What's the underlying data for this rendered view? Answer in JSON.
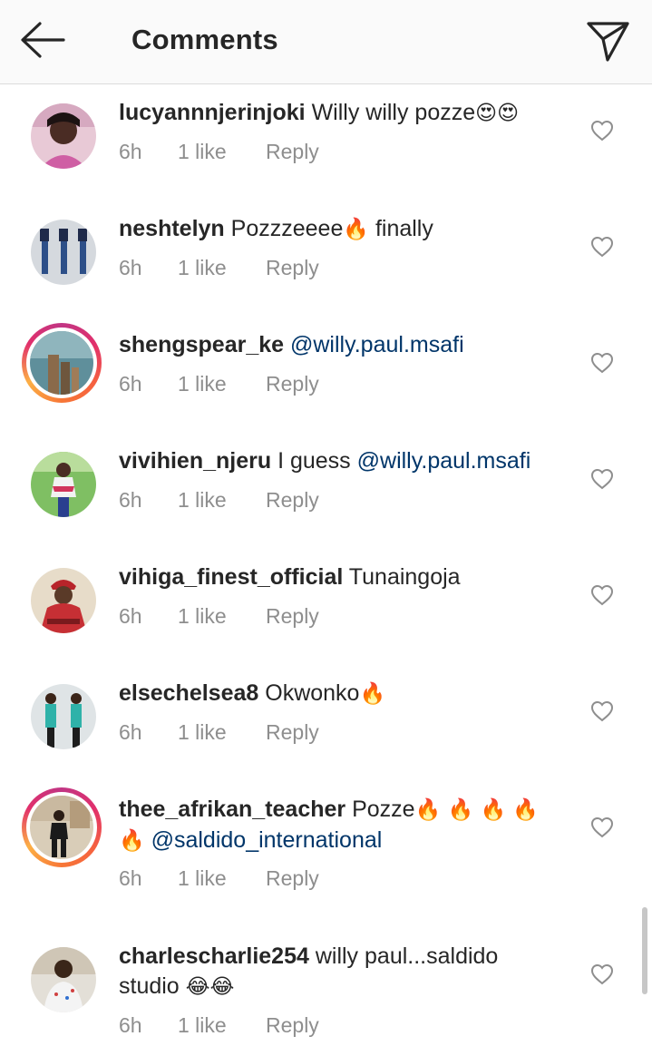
{
  "header": {
    "title": "Comments",
    "back_icon": "arrow-left-icon",
    "send_icon": "paper-plane-icon"
  },
  "colors": {
    "text": "#262626",
    "meta": "#8e8e8e",
    "mention": "#003569",
    "header_bg": "#fafafa",
    "story_ring": "#e1306c"
  },
  "comments": [
    {
      "username": "lucyannnjerinjoki",
      "body": "Willy willy pozze",
      "emoji": "😍😍",
      "time": "6h",
      "likes": "1 like",
      "reply": "Reply",
      "story_ring": false
    },
    {
      "username": "neshtelyn",
      "body": "Pozzzeeee",
      "emoji": "🔥",
      "body_after": " finally",
      "time": "6h",
      "likes": "1 like",
      "reply": "Reply",
      "story_ring": false
    },
    {
      "username": "shengspear_ke",
      "mention": "@willy.paul.msafi",
      "time": "6h",
      "likes": "1 like",
      "reply": "Reply",
      "story_ring": true
    },
    {
      "username": "vivihien_njeru",
      "body": "I guess ",
      "mention": "@willy.paul.msafi",
      "time": "6h",
      "likes": "1 like",
      "reply": "Reply",
      "story_ring": false
    },
    {
      "username": "vihiga_finest_official",
      "body": "Tunaingoja",
      "time": "6h",
      "likes": "1 like",
      "reply": "Reply",
      "story_ring": false
    },
    {
      "username": "elsechelsea8",
      "body": "Okwonko",
      "emoji": "🔥",
      "time": "6h",
      "likes": "1 like",
      "reply": "Reply",
      "story_ring": false
    },
    {
      "username": "thee_afrikan_teacher",
      "body": "Pozze",
      "emoji": "🔥 🔥 🔥 🔥",
      "emoji_line2": "🔥",
      "mention": "@saldido_international",
      "time": "6h",
      "likes": "1 like",
      "reply": "Reply",
      "story_ring": true
    },
    {
      "username": "charlescharlie254",
      "body": "willy paul...saldido",
      "body_line2": "studio ",
      "emoji": "😂😂",
      "time": "6h",
      "likes": "1 like",
      "reply": "Reply",
      "story_ring": false
    }
  ]
}
